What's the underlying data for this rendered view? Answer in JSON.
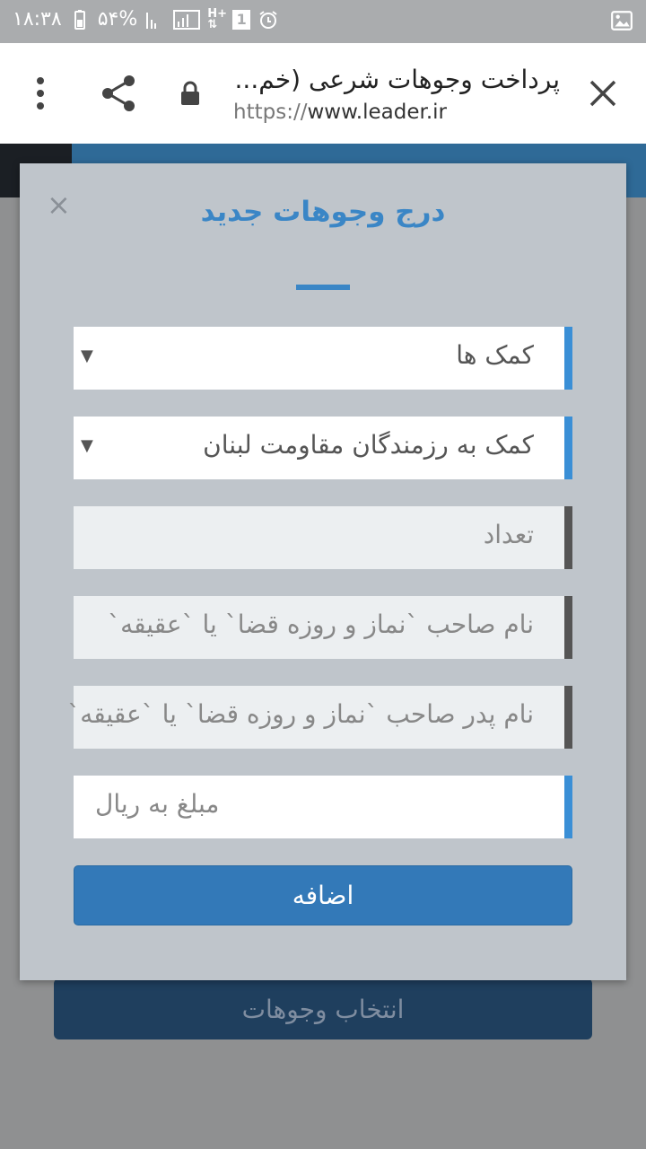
{
  "statusbar": {
    "time": "۱۸:۳۸",
    "battery": "۵۴%"
  },
  "browser": {
    "title": "پرداخت وجوهات شرعی (خم...",
    "url_proto": "https://",
    "url_host": "www.leader.ir"
  },
  "background": {
    "button_label": "انتخاب وجوهات"
  },
  "modal": {
    "close": "×",
    "title": "درج وجوهات جدید",
    "select1": "کمک ها",
    "select2": "کمک به رزمندگان مقاومت لبنان",
    "count_placeholder": "تعداد",
    "name_placeholder": "نام صاحب `نماز و روزه قضا` یا `عقیقه`",
    "father_placeholder": "نام پدر صاحب `نماز و روزه قضا` یا `عقیقه`",
    "amount_placeholder": "مبلغ به ریال",
    "add_label": "اضافه"
  },
  "colors": {
    "accent": "#3a86c6",
    "button": "#3379b8"
  }
}
